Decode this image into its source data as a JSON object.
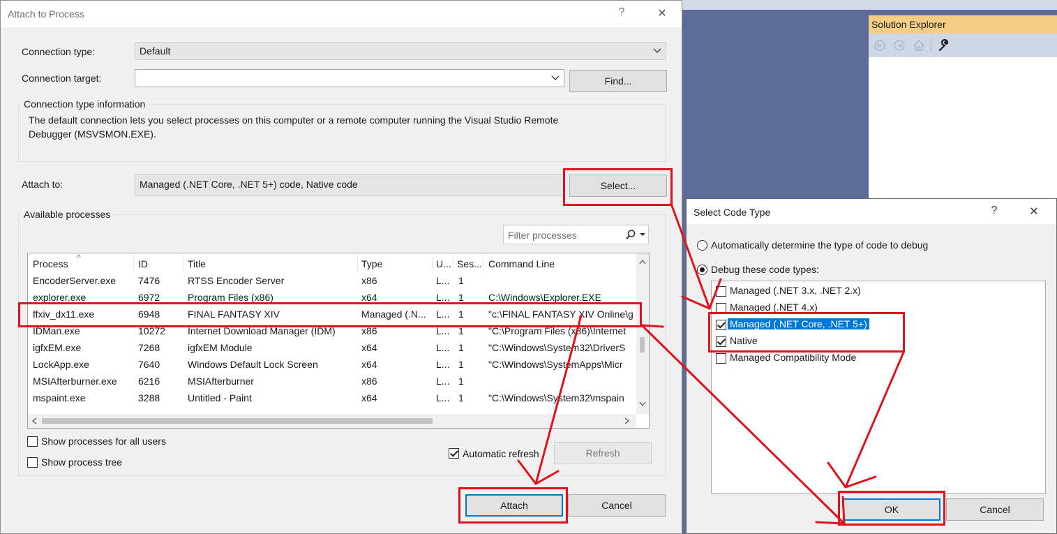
{
  "attach_dialog": {
    "title": "Attach to Process",
    "help": "?",
    "close": "✕",
    "connection_type_label": "Connection type:",
    "connection_type_value": "Default",
    "connection_target_label": "Connection target:",
    "connection_target_value": "",
    "find_button": "Find...",
    "info_title": "Connection type information",
    "info_text_line1": "The default connection lets you select processes on this computer or a remote computer running the Visual Studio Remote",
    "info_text_line2": "Debugger (MSVSMON.EXE).",
    "attach_to_label": "Attach to:",
    "attach_to_value": "Managed (.NET Core, .NET 5+) code, Native code",
    "select_button": "Select...",
    "available_processes_title": "Available processes",
    "filter_placeholder": "Filter processes",
    "columns": [
      "Process",
      "ID",
      "Title",
      "Type",
      "U...",
      "Ses...",
      "Command Line"
    ],
    "processes": [
      {
        "process": "EncoderServer.exe",
        "id": "7476",
        "title": "RTSS Encoder Server",
        "type": "x86",
        "user": "L...",
        "session": "1",
        "cmd": ""
      },
      {
        "process": "explorer.exe",
        "id": "6972",
        "title": "Program Files (x86)",
        "type": "x64",
        "user": "L...",
        "session": "1",
        "cmd": "C:\\Windows\\Explorer.EXE"
      },
      {
        "process": "ffxiv_dx11.exe",
        "id": "6948",
        "title": "FINAL FANTASY XIV",
        "type": "Managed (.N...",
        "user": "L...",
        "session": "1",
        "cmd": "\"c:\\FINAL FANTASY XIV Online\\g"
      },
      {
        "process": "IDMan.exe",
        "id": "10272",
        "title": "Internet Download Manager (IDM)",
        "type": "x86",
        "user": "L...",
        "session": "1",
        "cmd": "\"C:\\Program Files (x86)\\Internet"
      },
      {
        "process": "igfxEM.exe",
        "id": "7268",
        "title": "igfxEM Module",
        "type": "x64",
        "user": "L...",
        "session": "1",
        "cmd": "\"C:\\Windows\\System32\\DriverS"
      },
      {
        "process": "LockApp.exe",
        "id": "7640",
        "title": "Windows Default Lock Screen",
        "type": "x64",
        "user": "L...",
        "session": "1",
        "cmd": "\"C:\\Windows\\SystemApps\\Micr"
      },
      {
        "process": "MSIAfterburner.exe",
        "id": "6216",
        "title": "MSIAfterburner",
        "type": "x86",
        "user": "L...",
        "session": "1",
        "cmd": ""
      },
      {
        "process": "mspaint.exe",
        "id": "3288",
        "title": "Untitled - Paint",
        "type": "x64",
        "user": "L...",
        "session": "1",
        "cmd": "\"C:\\Windows\\System32\\mspain"
      }
    ],
    "show_all_users": "Show processes for all users",
    "show_tree": "Show process tree",
    "auto_refresh": "Automatic refresh",
    "refresh_button": "Refresh",
    "attach_button": "Attach",
    "cancel_button": "Cancel"
  },
  "solution_explorer": {
    "title": "Solution Explorer"
  },
  "code_type_dialog": {
    "title": "Select Code Type",
    "help": "?",
    "close": "✕",
    "auto_option": "Automatically determine the type of code to debug",
    "debug_option": "Debug these code types:",
    "code_types": [
      {
        "label": "Managed (.NET 3.x, .NET 2.x)",
        "checked": false
      },
      {
        "label": "Managed (.NET 4.x)",
        "checked": false
      },
      {
        "label": "Managed (.NET Core, .NET 5+)",
        "checked": true
      },
      {
        "label": "Native",
        "checked": true
      },
      {
        "label": "Managed Compatibility Mode",
        "checked": false
      }
    ],
    "ok_button": "OK",
    "cancel_button": "Cancel"
  },
  "colors": {
    "highlight": "#e0121b",
    "accent": "#0078d7",
    "solution_explorer_header": "#f5cc84",
    "background": "#5d6b99"
  }
}
